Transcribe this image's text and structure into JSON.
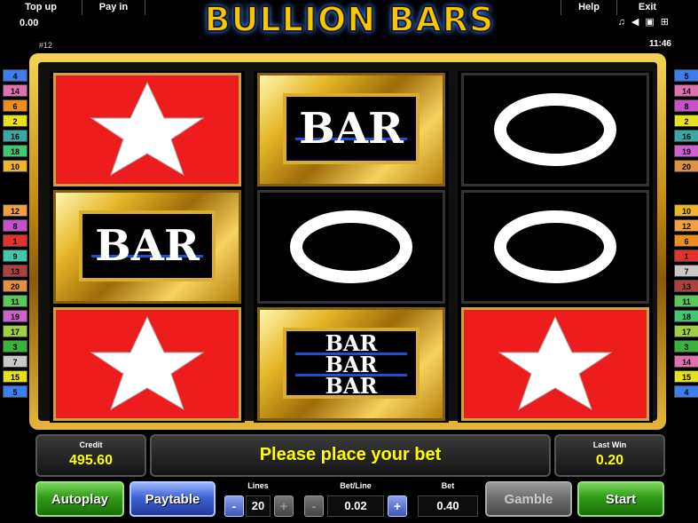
{
  "topbar": {
    "top_up": "Top up",
    "pay_in": "Pay in",
    "help": "Help",
    "exit": "Exit",
    "balance": "0.00",
    "clock": "11:46",
    "game_id": "#12",
    "icons": [
      "music-icon",
      "sound-muted-icon",
      "fullscreen-icon",
      "settings-icon"
    ]
  },
  "title": "BULLION BARS",
  "paylines_left": [
    "4",
    "14",
    "6",
    "2",
    "16",
    "18",
    "10",
    "12",
    "8",
    "1",
    "9",
    "13",
    "20",
    "11",
    "19",
    "17",
    "3",
    "7",
    "15",
    "5"
  ],
  "paylines_right": [
    "4",
    "5",
    "8",
    "2",
    "16",
    "19",
    "20",
    "10",
    "12",
    "6",
    "1",
    "7",
    "13",
    "11",
    "18",
    "17",
    "3",
    "14",
    "15",
    "4"
  ],
  "paylines_right_fixed": [
    "5",
    "14",
    "8",
    "2",
    "16",
    "19",
    "20",
    "10",
    "12",
    "6",
    "1",
    "7",
    "13",
    "11",
    "18",
    "17",
    "3",
    "14",
    "15",
    "4"
  ],
  "reels": [
    [
      "star",
      "single-bar",
      "star"
    ],
    [
      "single-bar",
      "seven-ring",
      "triple-bar"
    ],
    [
      "seven-ring",
      "seven-ring",
      "star"
    ]
  ],
  "symbols": {
    "bar": "BAR"
  },
  "status": {
    "credit_label": "Credit",
    "credit": "495.60",
    "message": "Please place your bet",
    "last_win_label": "Last Win",
    "last_win": "0.20"
  },
  "controls": {
    "autoplay": "Autoplay",
    "paytable": "Paytable",
    "lines_label": "Lines",
    "lines": "20",
    "bet_line_label": "Bet/Line",
    "bet_line": "0.02",
    "bet_label": "Bet",
    "bet": "0.40",
    "gamble": "Gamble",
    "start": "Start",
    "minus": "-",
    "plus": "+"
  },
  "colors": {
    "accent_yellow": "#ffff00",
    "reel_red": "#ee1c1c",
    "gold": "#e5b526",
    "start_green": "#2f9b17",
    "paytable_blue": "#3d62d4"
  }
}
